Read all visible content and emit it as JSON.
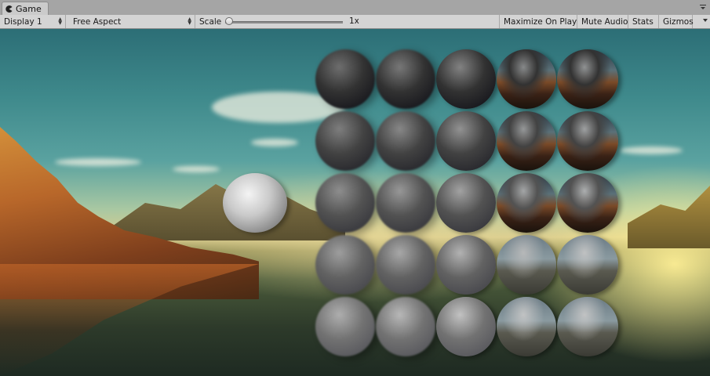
{
  "tab": {
    "title": "Game",
    "icon": "game-pacman-icon"
  },
  "toolbar": {
    "display_label": "Display 1",
    "aspect_label": "Free Aspect",
    "scale_label": "Scale",
    "scale_value": "1x",
    "scale_fraction": 0.0,
    "maximize_label": "Maximize On Play",
    "mute_label": "Mute Audio",
    "stats_label": "Stats",
    "gizmos_label": "Gizmos"
  },
  "scene": {
    "sky_color": "#3f8a8c",
    "reference_sphere_color": "#d8d8d8",
    "grid_rows": 5,
    "grid_cols": 5,
    "grid_description_colors": [
      "#3a3a3a",
      "#4a4a4a",
      "#5a5a5a",
      "#3b2a1f",
      "#2a1e16"
    ]
  }
}
